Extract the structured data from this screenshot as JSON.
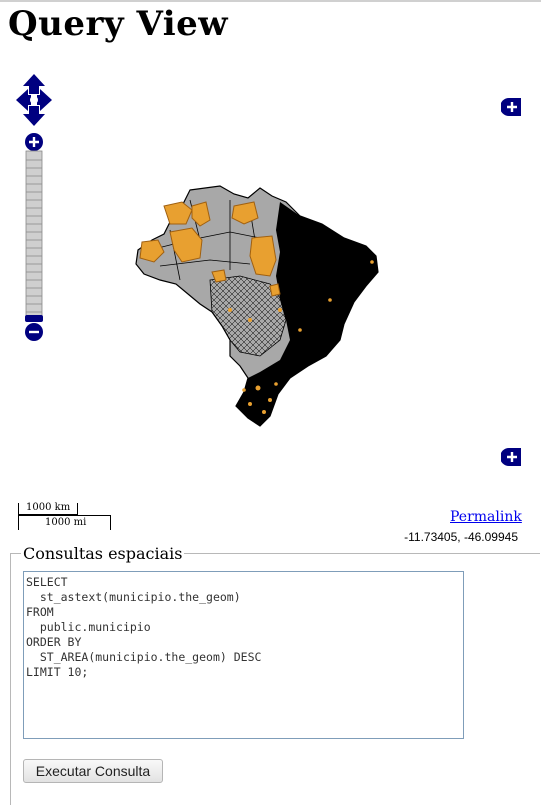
{
  "page": {
    "title": "Query View"
  },
  "map": {
    "pan_control_icon": "pan-arrows-icon",
    "zoom_in_icon": "plus-icon",
    "zoom_out_icon": "minus-icon",
    "layer_switcher_icon": "plus-icon",
    "colors": {
      "control_blue": "#000080",
      "land_gray": "#a8a8a8",
      "dense_black": "#000000",
      "highlight_orange": "#e8a030"
    },
    "scale": {
      "km_label": "1000 km",
      "mi_label": "1000 mi"
    },
    "permalink_label": "Permalink",
    "coordinates": "-11.73405, -46.09945"
  },
  "query_panel": {
    "legend": "Consultas espaciais",
    "sql_text": "SELECT\n  st_astext(municipio.the_geom)\nFROM\n  public.municipio\nORDER BY\n  ST_AREA(municipio.the_geom) DESC\nLIMIT 10;",
    "run_button_label": "Executar Consulta"
  }
}
